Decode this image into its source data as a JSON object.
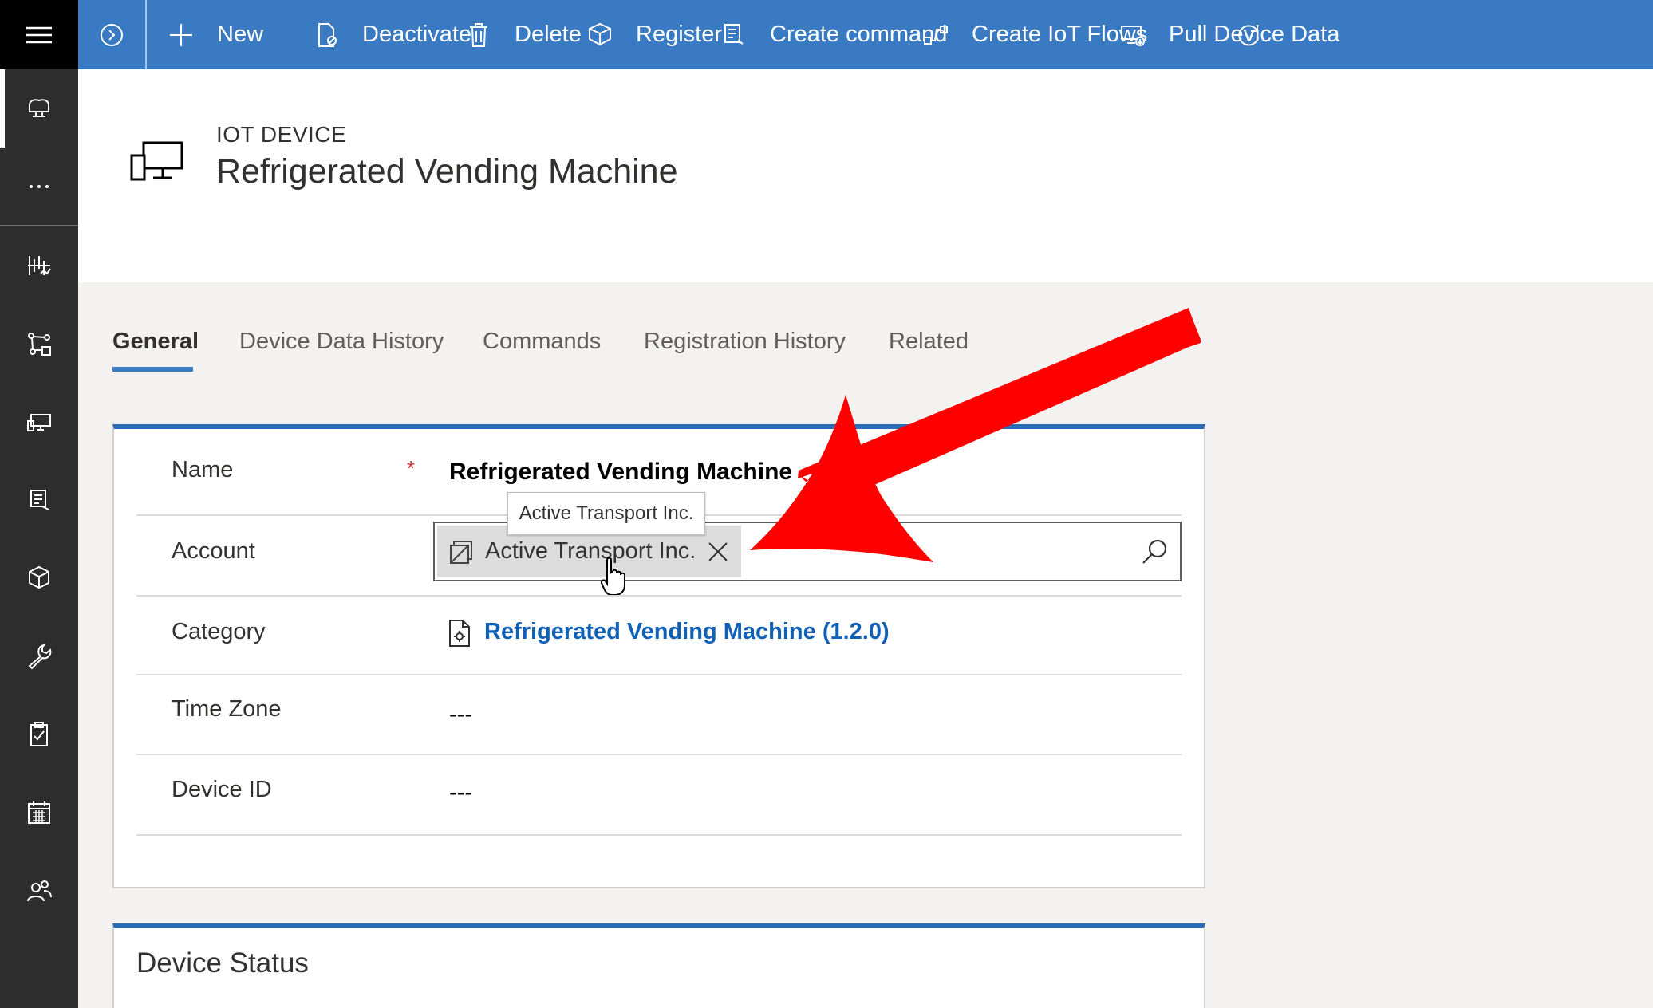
{
  "commandbar": {
    "new_label": "New",
    "deactivate_label": "Deactivate",
    "delete_label": "Delete",
    "register_label": "Register",
    "create_command_label": "Create command",
    "create_iot_flows_label": "Create IoT Flows",
    "pull_device_data_label": "Pull Device Data"
  },
  "header": {
    "entity_type": "IOT DEVICE",
    "title": "Refrigerated Vending Machine"
  },
  "tabs": [
    {
      "label": "General",
      "active": true
    },
    {
      "label": "Device Data History"
    },
    {
      "label": "Commands"
    },
    {
      "label": "Registration History"
    },
    {
      "label": "Related"
    }
  ],
  "form": {
    "name_label": "Name",
    "required_marker": "*",
    "name_value": "Refrigerated Vending Machine",
    "account_label": "Account",
    "account_value": "Active Transport Inc.",
    "account_tooltip": "Active Transport Inc.",
    "category_label": "Category",
    "category_value": "Refrigerated Vending Machine (1.2.0)",
    "timezone_label": "Time Zone",
    "timezone_value": "---",
    "deviceid_label": "Device ID",
    "deviceid_value": "---"
  },
  "device_status": {
    "title": "Device Status"
  },
  "colors": {
    "command_bar": "#3a7ac3",
    "left_nav": "#2d2d2d",
    "accent": "#2b6cb8",
    "link": "#1160b7",
    "annotation_arrow": "#ff0000"
  }
}
